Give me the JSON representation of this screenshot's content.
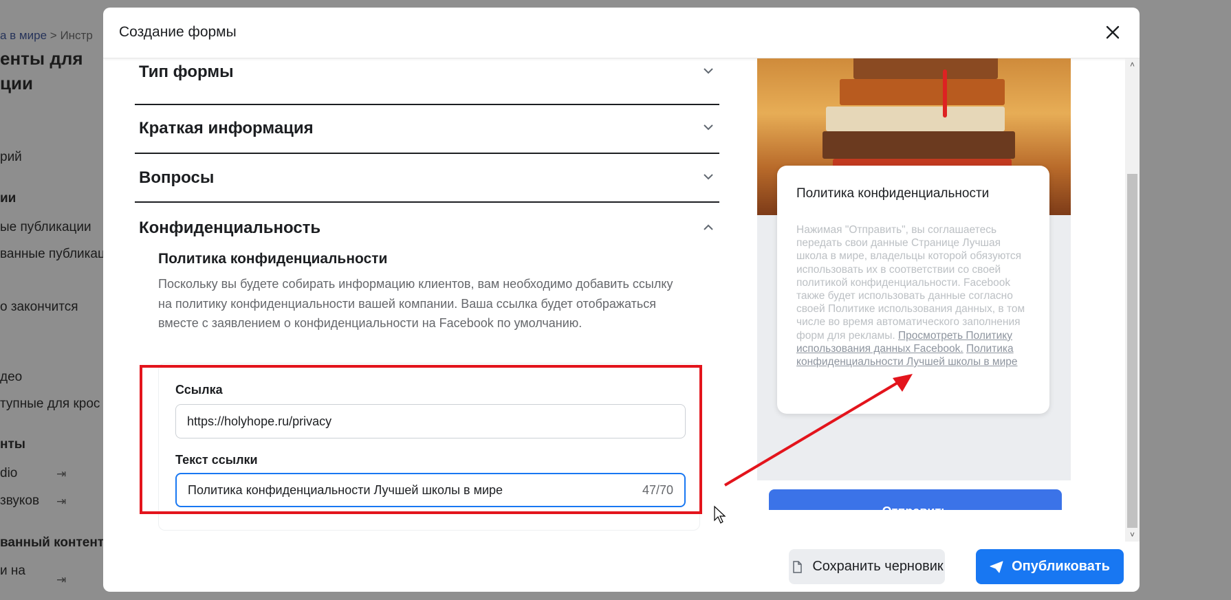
{
  "background": {
    "breadcrumb_link": "а в мире",
    "breadcrumb_sep": ">",
    "breadcrumb_current": "Инстр",
    "heading_line1": "енты для",
    "heading_line2": "ции",
    "items": [
      "рий",
      "ии",
      "ые публикации",
      "ванные публикаци",
      "о закончится",
      "део",
      "тупные для крос",
      "нты",
      "dio",
      "звуков",
      "ванный контент",
      "и на"
    ]
  },
  "modal": {
    "title": "Создание формы",
    "sections": [
      {
        "label": "Тип формы",
        "expanded": false
      },
      {
        "label": "Краткая информация",
        "expanded": false
      },
      {
        "label": "Вопросы",
        "expanded": false
      },
      {
        "label": "Конфиденциальность",
        "expanded": true
      }
    ],
    "privacy": {
      "title": "Политика конфиденциальности",
      "description": "Поскольку вы будете собирать информацию клиентов, вам необходимо добавить ссылку на политику конфиденциальности вашей компании. Ваша ссылка будет отображаться вместе с заявлением о конфиденциальности на Facebook по умолчанию.",
      "link_label": "Ссылка",
      "link_value": "https://holyhope.ru/privacy",
      "link_text_label": "Текст ссылки",
      "link_text_value": "Политика конфиденциальности Лучшей школы в мире",
      "link_text_counter": "47/70"
    },
    "preview": {
      "heading": "Политика конфиденциальности",
      "body": "Нажимая \"Отправить\", вы соглашаетесь передать свои данные Странице Лучшая школа в мире, владельцы которой обязуются использовать их в соответствии со своей политикой конфиденциальности. Facebook также будет использовать данные согласно своей Политике использования данных, в том числе во время автоматического заполнения форм для рекламы.",
      "link1": "Просмотреть Политику использования данных Facebook.",
      "link2": "Политика конфиденциальности Лучшей школы в мире",
      "submit_label": "Отправить"
    },
    "footer": {
      "draft_label": "Сохранить черновик",
      "publish_label": "Опубликовать"
    }
  },
  "colors": {
    "primary": "#1877f2",
    "highlight": "#e3141c",
    "overlay": "#8f8f8f"
  }
}
